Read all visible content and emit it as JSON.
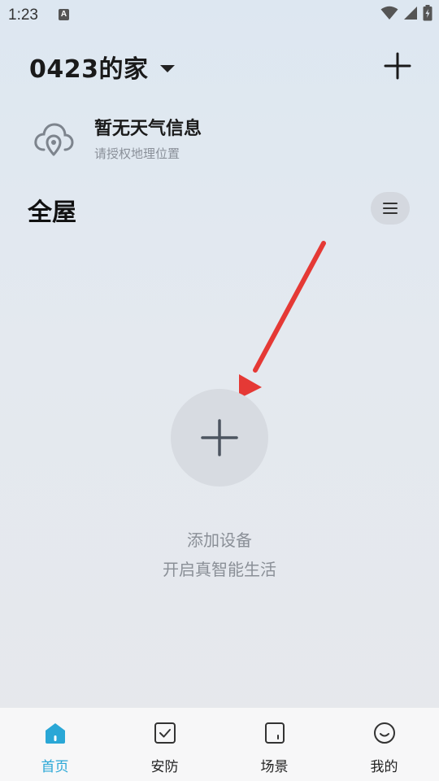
{
  "status_bar": {
    "time": "1:23",
    "notification_icon": "A"
  },
  "header": {
    "home_name": "0423的家"
  },
  "weather": {
    "title": "暂无天气信息",
    "subtitle": "请授权地理位置"
  },
  "section": {
    "title": "全屋"
  },
  "empty_state": {
    "title": "添加设备",
    "subtitle": "开启真智能生活"
  },
  "bottom_nav": {
    "items": [
      {
        "label": "首页",
        "icon": "home-icon",
        "active": true
      },
      {
        "label": "安防",
        "icon": "security-check-icon",
        "active": false
      },
      {
        "label": "场景",
        "icon": "scene-icon",
        "active": false
      },
      {
        "label": "我的",
        "icon": "profile-smile-icon",
        "active": false
      }
    ]
  },
  "colors": {
    "accent": "#2aa7d6",
    "annotation_arrow": "#e53935"
  }
}
